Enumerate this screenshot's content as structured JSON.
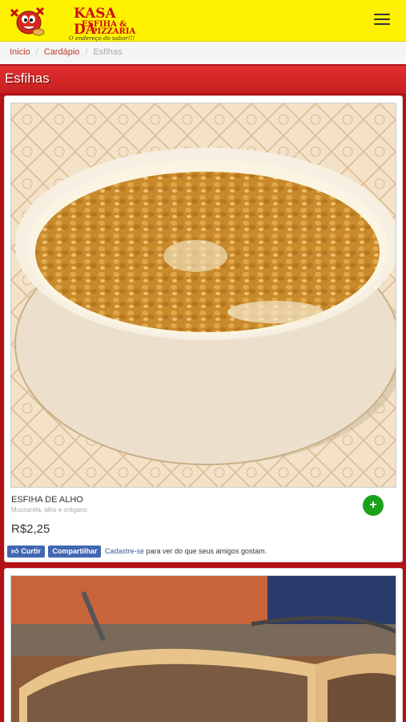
{
  "header": {
    "logo_line1": "KASA DA",
    "logo_line2a": "ESFIHA &",
    "logo_line2b": "PIZZARIA",
    "logo_tagline": "O endereço do sabor!!!",
    "menu_icon": "hamburger-menu-icon"
  },
  "breadcrumb": {
    "items": [
      "Inicio",
      "Cardápio",
      "Esfihas"
    ]
  },
  "section": {
    "title": "Esfihas"
  },
  "products": [
    {
      "name": "ESFIHA DE ALHO",
      "description": "Mussarela, alho e orégano",
      "price": "R$2,25",
      "add_icon": "plus-icon"
    }
  ],
  "social": {
    "like_label": "Curtir",
    "share_label": "Compartilhar",
    "signup_link": "Cadastre-se",
    "signup_text": " para ver do que seus amigos gostam."
  },
  "colors": {
    "header_bg": "#fff200",
    "brand_red": "#c81f20",
    "facebook_blue": "#4267b2",
    "add_green": "#1aa31a"
  }
}
